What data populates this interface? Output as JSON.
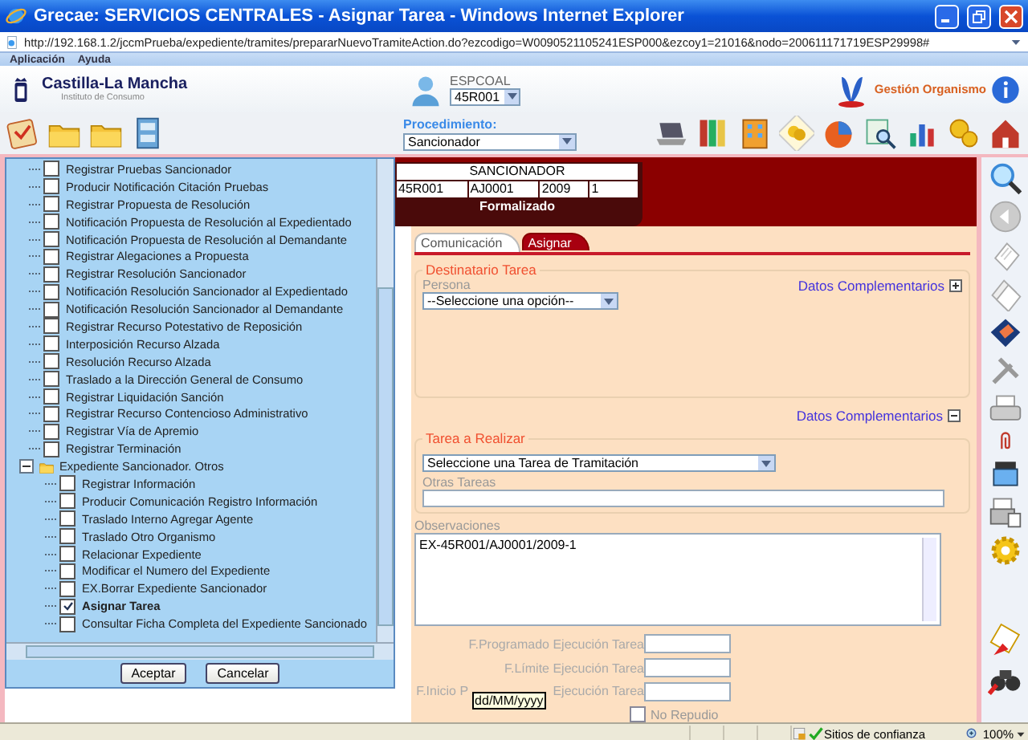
{
  "window": {
    "title": "Grecae: SERVICIOS CENTRALES - Asignar Tarea - Windows Internet Explorer"
  },
  "address_bar": {
    "url": "http://192.168.1.2/jccmPrueba/expediente/tramites/prepararNuevoTramiteAction.do?ezcodigo=W0090521105241ESP000&ezcoy1=21016&nodo=200611171719ESP29998#"
  },
  "menu": [
    "Aplicación",
    "Ayuda"
  ],
  "header": {
    "org_name": "Castilla-La Mancha",
    "org_subtitle": "Instituto de Consumo",
    "user": "ESPCOAL",
    "office_select": "45R001",
    "app_link": "Gestión Organismo"
  },
  "toolbar": {
    "procedure_label": "Procedimiento:",
    "procedure_select": "Sancionador"
  },
  "tree": [
    {
      "kind": "group",
      "children": [
        {
          "kind": "task",
          "label": "Registrar Pruebas Sancionador",
          "checked": false
        },
        {
          "kind": "task",
          "label": "Producir Notificación Citación Pruebas",
          "checked": false
        },
        {
          "kind": "task",
          "label": "Registrar Propuesta de Resolución",
          "checked": false
        },
        {
          "kind": "task",
          "label": "Notificación Propuesta de Resolución al Expedientado",
          "checked": false
        },
        {
          "kind": "task",
          "label": "Notificación Propuesta de Resolución al Demandante",
          "checked": false
        },
        {
          "kind": "task",
          "label": "Registrar Alegaciones a Propuesta",
          "checked": false
        },
        {
          "kind": "task",
          "label": "Registrar Resolución Sancionador",
          "checked": false
        },
        {
          "kind": "task",
          "label": "Notificación Resolución Sancionador al Expedientado",
          "checked": false
        },
        {
          "kind": "task",
          "label": "Notificación Resolución Sancionador al Demandante",
          "checked": false
        },
        {
          "kind": "task",
          "label": "Registrar Recurso Potestativo de Reposición",
          "checked": false
        },
        {
          "kind": "task",
          "label": "Interposición Recurso Alzada",
          "checked": false
        },
        {
          "kind": "task",
          "label": "Resolución Recurso Alzada",
          "checked": false
        },
        {
          "kind": "task",
          "label": "Traslado a la Dirección General de Consumo",
          "checked": false
        },
        {
          "kind": "task",
          "label": "Registrar Liquidación Sanción",
          "checked": false
        },
        {
          "kind": "task",
          "label": "Registrar Recurso Contencioso Administrativo",
          "checked": false
        },
        {
          "kind": "task",
          "label": "Registrar Vía de Apremio",
          "checked": false
        },
        {
          "kind": "task",
          "label": "Registrar Terminación",
          "checked": false
        }
      ]
    },
    {
      "kind": "folder",
      "label": "Expediente Sancionador. Otros",
      "expanded": true,
      "children": [
        {
          "kind": "task",
          "label": "Registrar Información",
          "checked": false
        },
        {
          "kind": "task",
          "label": "Producir Comunicación Registro Información",
          "checked": false
        },
        {
          "kind": "task",
          "label": "Traslado Interno Agregar Agente",
          "checked": false
        },
        {
          "kind": "task",
          "label": "Traslado Otro Organismo",
          "checked": false
        },
        {
          "kind": "task",
          "label": "Relacionar Expediente",
          "checked": false
        },
        {
          "kind": "task",
          "label": "Modificar el Numero del Expediente",
          "checked": false
        },
        {
          "kind": "task",
          "label": "EX.Borrar Expediente Sancionador",
          "checked": false
        },
        {
          "kind": "task",
          "label": "Asignar Tarea",
          "checked": true
        },
        {
          "kind": "task",
          "label": "Consultar Ficha Completa del Expediente Sancionado",
          "checked": false
        }
      ]
    }
  ],
  "tree_buttons": [
    "Aceptar",
    "Cancelar"
  ],
  "case": {
    "type": "SANCIONADOR",
    "fields": [
      "45R001",
      "AJ0001",
      "2009",
      "1"
    ],
    "status": "Formalizado"
  },
  "tabs": [
    {
      "label": "Comunicación",
      "selected": false
    },
    {
      "label": "Asignar",
      "selected": true
    }
  ],
  "recipient": {
    "legend": "Destinatario Tarea",
    "person_label": "Persona",
    "person_select": "--Seleccione una opción--",
    "more_link": "Datos Complementarios",
    "expanded": false
  },
  "more_section": {
    "label": "Datos Complementarios",
    "expanded": true
  },
  "task": {
    "legend": "Tarea a Realizar",
    "task_select": "Seleccione una Tarea de Tramitación",
    "other_label": "Otras Tareas"
  },
  "observations": {
    "label": "Observaciones",
    "value": "EX-45R001/AJ0001/2009-1"
  },
  "dates": [
    {
      "label": "F.Programado Ejecución Tarea"
    },
    {
      "label": "F.Límite Ejecución Tarea"
    },
    {
      "label": "F.Inicio P",
      "label_end": "Ejecución Tarea",
      "tooltip": "dd/MM/yyyy"
    }
  ],
  "no_repudio": {
    "label": "No Repudio",
    "checked": false
  },
  "status_bar": {
    "zone": "Sitios de confianza",
    "zoom": "100%"
  }
}
